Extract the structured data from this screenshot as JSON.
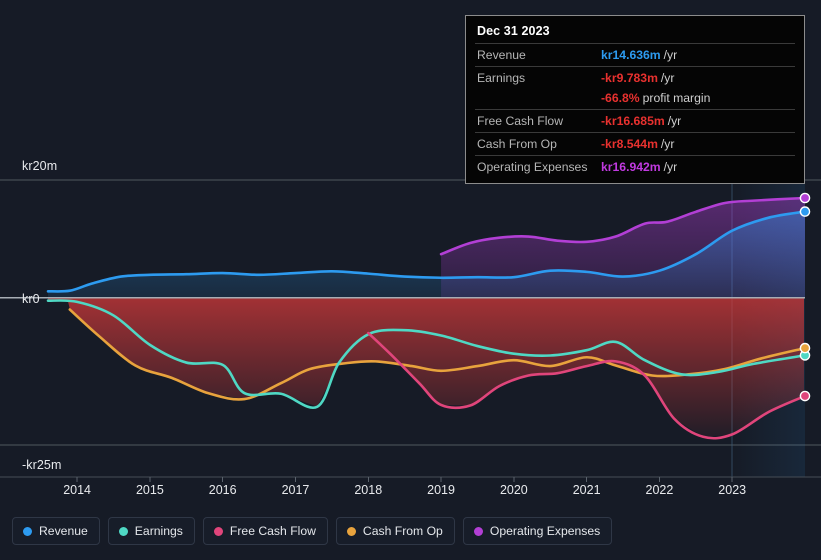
{
  "axis": {
    "y_top_label": "kr20m",
    "y_zero_label": "kr0",
    "y_bottom_label": "-kr25m",
    "x_labels": [
      "2014",
      "2015",
      "2016",
      "2017",
      "2018",
      "2019",
      "2020",
      "2021",
      "2022",
      "2023"
    ]
  },
  "tooltip": {
    "date": "Dec 31 2023",
    "rows": [
      {
        "label": "Revenue",
        "value": "kr14.636m",
        "unit": "/yr",
        "color": "#2d9bf0"
      },
      {
        "label": "Earnings",
        "value": "-kr9.783m",
        "unit": "/yr",
        "color": "#e8312f"
      },
      {
        "label": "",
        "value": "-66.8%",
        "unit": "profit margin",
        "color": "#e8312f"
      },
      {
        "label": "Free Cash Flow",
        "value": "-kr16.685m",
        "unit": "/yr",
        "color": "#e8312f"
      },
      {
        "label": "Cash From Op",
        "value": "-kr8.544m",
        "unit": "/yr",
        "color": "#e8312f"
      },
      {
        "label": "Operating Expenses",
        "value": "kr16.942m",
        "unit": "/yr",
        "color": "#c13ae0"
      }
    ]
  },
  "legend": [
    {
      "label": "Revenue",
      "color": "#2d9bf0"
    },
    {
      "label": "Earnings",
      "color": "#4fd8c4"
    },
    {
      "label": "Free Cash Flow",
      "color": "#e0457b"
    },
    {
      "label": "Cash From Op",
      "color": "#e8a33d"
    },
    {
      "label": "Operating Expenses",
      "color": "#b23fd5"
    }
  ],
  "chart_data": {
    "type": "line",
    "title": "",
    "xlabel": "",
    "ylabel": "",
    "currency": "kr",
    "unit": "m",
    "ylim": [
      -25,
      20
    ],
    "yticks": [
      20,
      0,
      -25
    ],
    "grid": true,
    "x": [
      2013.6,
      2014,
      2015,
      2016,
      2017,
      2018,
      2019,
      2020,
      2021,
      2022,
      2023,
      2024.0
    ],
    "forecast_start": 2023.0,
    "series": [
      {
        "name": "Revenue",
        "color": "#2d9bf0",
        "x": [
          2013.6,
          2013.9,
          2014.2,
          2014.6,
          2015.0,
          2015.5,
          2016.0,
          2016.5,
          2017.0,
          2017.5,
          2018.0,
          2018.5,
          2019.0,
          2019.5,
          2020.0,
          2020.5,
          2021.0,
          2021.5,
          2022.0,
          2022.5,
          2023.0,
          2023.5,
          2024.0
        ],
        "values": [
          1.1,
          1.2,
          2.4,
          3.6,
          3.9,
          4.0,
          4.2,
          3.9,
          4.2,
          4.5,
          4.1,
          3.6,
          3.4,
          3.5,
          3.5,
          4.6,
          4.4,
          3.6,
          4.6,
          7.4,
          11.4,
          13.6,
          14.636
        ]
      },
      {
        "name": "Earnings",
        "color": "#4fd8c4",
        "x": [
          2013.6,
          2014.0,
          2014.5,
          2015.0,
          2015.5,
          2016.0,
          2016.3,
          2016.8,
          2017.3,
          2017.6,
          2018.0,
          2018.5,
          2019.0,
          2019.5,
          2020.0,
          2020.5,
          2021.0,
          2021.4,
          2021.8,
          2022.3,
          2022.8,
          2023.3,
          2024.0
        ],
        "values": [
          -0.5,
          -0.7,
          -3.0,
          -8.0,
          -11.0,
          -11.4,
          -16.2,
          -16.3,
          -18.5,
          -11.0,
          -6.2,
          -5.5,
          -6.4,
          -8.2,
          -9.5,
          -9.8,
          -8.9,
          -7.5,
          -10.6,
          -13.0,
          -12.6,
          -11.2,
          -9.783
        ]
      },
      {
        "name": "Free Cash Flow",
        "color": "#e0457b",
        "x": [
          2018.0,
          2018.3,
          2018.7,
          2019.0,
          2019.4,
          2019.8,
          2020.2,
          2020.6,
          2021.0,
          2021.4,
          2021.8,
          2022.2,
          2022.6,
          2023.0,
          2023.5,
          2024.0
        ],
        "values": [
          -6.0,
          -9.5,
          -14.5,
          -18.2,
          -18.3,
          -15.0,
          -13.2,
          -12.8,
          -11.6,
          -10.8,
          -13.2,
          -20.5,
          -23.6,
          -23.2,
          -19.4,
          -16.685
        ]
      },
      {
        "name": "Cash From Op",
        "color": "#e8a33d",
        "x": [
          2013.9,
          2014.3,
          2014.8,
          2015.3,
          2015.8,
          2016.3,
          2016.8,
          2017.2,
          2017.7,
          2018.1,
          2018.6,
          2019.0,
          2019.5,
          2020.0,
          2020.5,
          2021.0,
          2021.4,
          2021.9,
          2022.4,
          2022.9,
          2023.4,
          2024.0
        ],
        "values": [
          -2.0,
          -6.5,
          -11.5,
          -13.6,
          -16.2,
          -17.2,
          -14.5,
          -12.1,
          -11.1,
          -10.8,
          -11.6,
          -12.4,
          -11.6,
          -10.6,
          -11.6,
          -10.1,
          -11.5,
          -13.2,
          -13.0,
          -12.1,
          -10.3,
          -8.544
        ]
      },
      {
        "name": "Operating Expenses",
        "color": "#b23fd5",
        "x": [
          2019.0,
          2019.4,
          2019.8,
          2020.2,
          2020.6,
          2021.0,
          2021.4,
          2021.8,
          2022.1,
          2022.5,
          2022.9,
          2023.3,
          2024.0
        ],
        "values": [
          7.4,
          9.3,
          10.2,
          10.4,
          9.7,
          9.5,
          10.4,
          12.6,
          12.9,
          14.6,
          16.1,
          16.5,
          16.942
        ]
      }
    ]
  }
}
